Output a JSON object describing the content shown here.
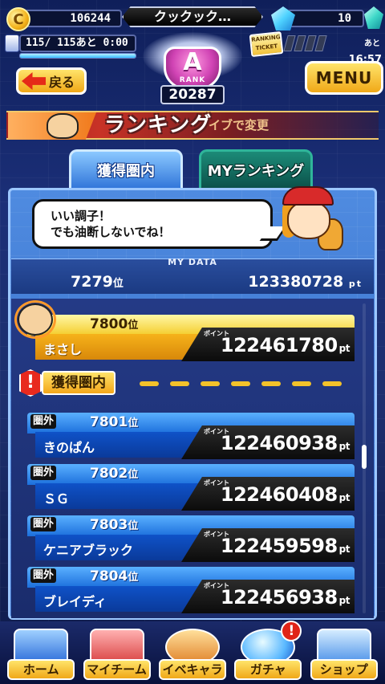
{
  "status": {
    "coins": "106244",
    "player_name": "クックック…",
    "gems": "10",
    "stamina_text": "115/ 115あと 0:00",
    "stamina_fill": 1.0,
    "ticket_label": "RANKING TICKET",
    "timer_prefix": "あと",
    "timer_value": "16:57"
  },
  "rank": {
    "letter": "A",
    "label": "RANK",
    "points": "20287"
  },
  "nav_top": {
    "back_label": "戻る",
    "menu_label": "MENU"
  },
  "title": {
    "main": "ランキング",
    "sub": "イブで変更"
  },
  "tabs": [
    {
      "label": "獲得圏内",
      "active": true
    },
    {
      "label": "MYランキング",
      "active": false
    }
  ],
  "speech": {
    "line1": "いい調子！",
    "line2": "でも油断しないでね！"
  },
  "my_data": {
    "label": "MY DATA",
    "rank": "7279",
    "rank_suffix": "位",
    "points": "123380728",
    "points_suffix": "pt"
  },
  "points_caption": "ポイント",
  "rows": [
    {
      "rank": "7800",
      "name": "まさし",
      "points": "122461780",
      "tag": "",
      "style": "mine"
    }
  ],
  "divider": {
    "label": "獲得圏内",
    "icon": "!"
  },
  "rows_below": [
    {
      "rank": "7801",
      "name": "きのぱん",
      "points": "122460938",
      "tag": "圏外"
    },
    {
      "rank": "7802",
      "name": "ＳＧ",
      "points": "122460408",
      "tag": "圏外"
    },
    {
      "rank": "7803",
      "name": "ケニアブラック",
      "points": "122459598",
      "tag": "圏外"
    },
    {
      "rank": "7804",
      "name": "ブレイディ",
      "points": "122456938",
      "tag": "圏外"
    }
  ],
  "rank_suffix": "位",
  "pt_suffix": "pt",
  "bottom_nav": [
    {
      "label": "ホーム",
      "icon": "home-icon"
    },
    {
      "label": "マイチーム",
      "icon": "team-icon"
    },
    {
      "label": "イベキャラ",
      "icon": "event-chara-icon"
    },
    {
      "label": "ガチャ",
      "icon": "gacha-icon",
      "alert": "!"
    },
    {
      "label": "ショップ",
      "icon": "shop-icon"
    }
  ]
}
